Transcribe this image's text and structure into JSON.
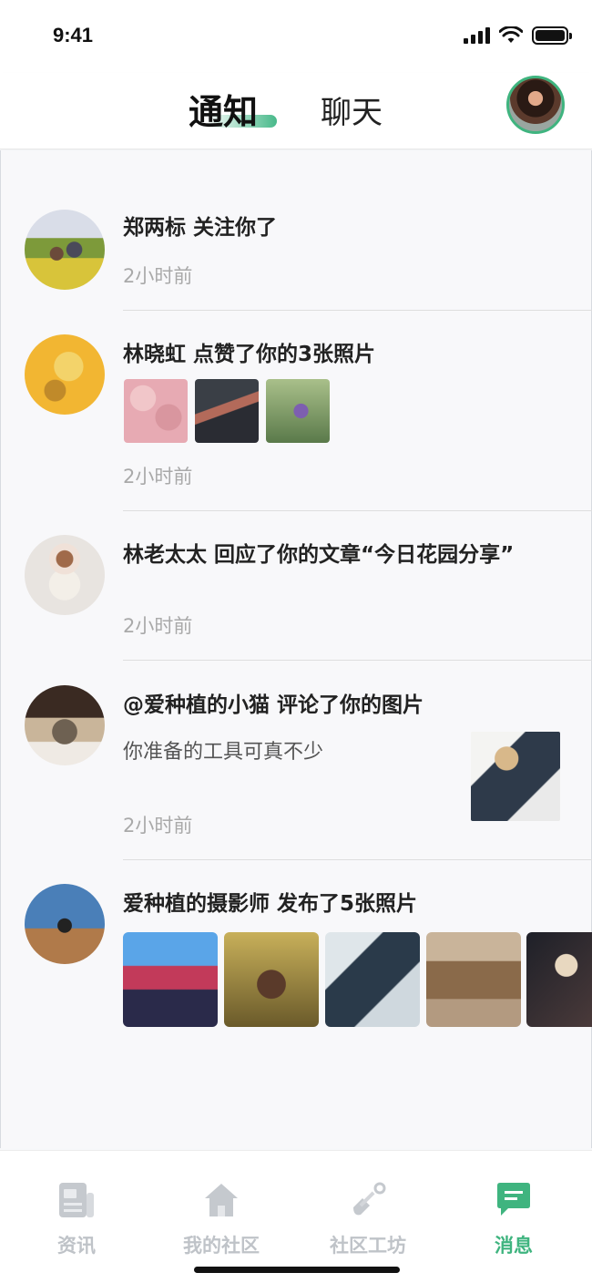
{
  "status_bar": {
    "time": "9:41"
  },
  "header": {
    "tab_notifications": "通知",
    "tab_chat": "聊天"
  },
  "feed": [
    {
      "title": "郑两标 关注你了",
      "time": "2小时前"
    },
    {
      "title": "林晓虹 点赞了你的3张照片",
      "time": "2小时前"
    },
    {
      "title": "林老太太 回应了你的文章“今日花园分享”",
      "time": "2小时前"
    },
    {
      "title": "@爱种植的小猫 评论了你的图片",
      "comment": "你准备的工具可真不少",
      "time": "2小时前"
    },
    {
      "title": "爱种植的摄影师 发布了5张照片"
    }
  ],
  "tabbar": {
    "news": "资讯",
    "my_community": "我的社区",
    "workshop": "社区工坊",
    "messages": "消息"
  },
  "colors": {
    "accent": "#3fb47f",
    "inactive": "#bfc3c8"
  }
}
